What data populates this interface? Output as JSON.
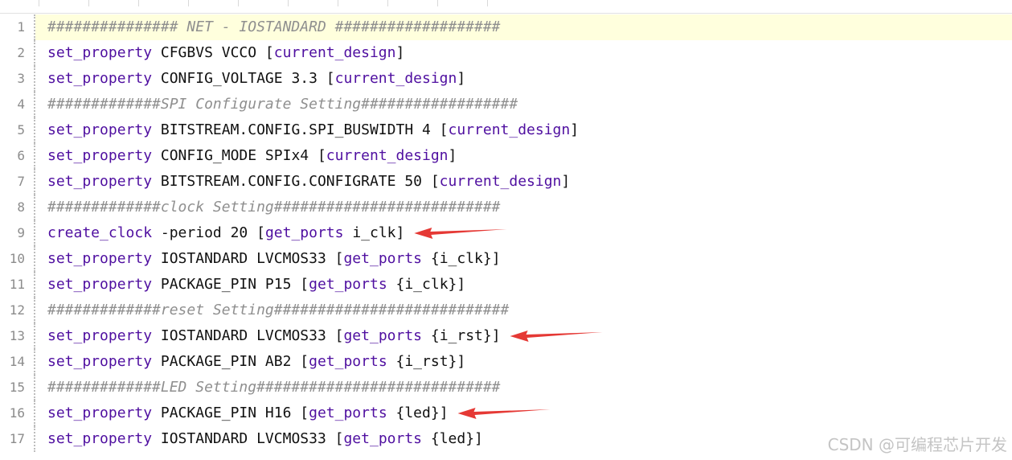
{
  "watermark": "CSDN @可编程芯片开发",
  "lines": [
    {
      "n": "1",
      "current": true,
      "parts": [
        {
          "t": "############### NET - IOSTANDARD ###################",
          "c": "cm"
        }
      ]
    },
    {
      "n": "2",
      "parts": [
        {
          "t": "set_property",
          "c": "kw"
        },
        {
          "t": " CFGBVS VCCO [",
          "c": "pl"
        },
        {
          "t": "current_design",
          "c": "kw"
        },
        {
          "t": "]",
          "c": "pl"
        }
      ]
    },
    {
      "n": "3",
      "parts": [
        {
          "t": "set_property",
          "c": "kw"
        },
        {
          "t": " CONFIG_VOLTAGE 3.3 [",
          "c": "pl"
        },
        {
          "t": "current_design",
          "c": "kw"
        },
        {
          "t": "]",
          "c": "pl"
        }
      ]
    },
    {
      "n": "4",
      "parts": [
        {
          "t": "#############SPI Configurate Setting##################",
          "c": "cm"
        }
      ]
    },
    {
      "n": "5",
      "parts": [
        {
          "t": "set_property",
          "c": "kw"
        },
        {
          "t": " BITSTREAM.CONFIG.SPI_BUSWIDTH 4 [",
          "c": "pl"
        },
        {
          "t": "current_design",
          "c": "kw"
        },
        {
          "t": "]",
          "c": "pl"
        }
      ]
    },
    {
      "n": "6",
      "parts": [
        {
          "t": "set_property",
          "c": "kw"
        },
        {
          "t": " CONFIG_MODE SPIx4 [",
          "c": "pl"
        },
        {
          "t": "current_design",
          "c": "kw"
        },
        {
          "t": "]",
          "c": "pl"
        }
      ]
    },
    {
      "n": "7",
      "parts": [
        {
          "t": "set_property",
          "c": "kw"
        },
        {
          "t": " BITSTREAM.CONFIG.CONFIGRATE 50 [",
          "c": "pl"
        },
        {
          "t": "current_design",
          "c": "kw"
        },
        {
          "t": "]",
          "c": "pl"
        }
      ]
    },
    {
      "n": "8",
      "parts": [
        {
          "t": "#############clock Setting##########################",
          "c": "cm"
        }
      ]
    },
    {
      "n": "9",
      "parts": [
        {
          "t": "create_clock",
          "c": "kw"
        },
        {
          "t": " -period 20 [",
          "c": "pl"
        },
        {
          "t": "get_ports",
          "c": "kw"
        },
        {
          "t": " i_clk]",
          "c": "pl"
        }
      ]
    },
    {
      "n": "10",
      "parts": [
        {
          "t": "set_property",
          "c": "kw"
        },
        {
          "t": " IOSTANDARD LVCMOS33 [",
          "c": "pl"
        },
        {
          "t": "get_ports",
          "c": "kw"
        },
        {
          "t": " {i_clk}]",
          "c": "pl"
        }
      ]
    },
    {
      "n": "11",
      "parts": [
        {
          "t": "set_property",
          "c": "kw"
        },
        {
          "t": " PACKAGE_PIN P15 [",
          "c": "pl"
        },
        {
          "t": "get_ports",
          "c": "kw"
        },
        {
          "t": " {i_clk}]",
          "c": "pl"
        }
      ]
    },
    {
      "n": "12",
      "parts": [
        {
          "t": "#############reset Setting###########################",
          "c": "cm"
        }
      ]
    },
    {
      "n": "13",
      "parts": [
        {
          "t": "set_property",
          "c": "kw"
        },
        {
          "t": " IOSTANDARD LVCMOS33 [",
          "c": "pl"
        },
        {
          "t": "get_ports",
          "c": "kw"
        },
        {
          "t": " {i_rst}]",
          "c": "pl"
        }
      ]
    },
    {
      "n": "14",
      "parts": [
        {
          "t": "set_property",
          "c": "kw"
        },
        {
          "t": " PACKAGE_PIN AB2 [",
          "c": "pl"
        },
        {
          "t": "get_ports",
          "c": "kw"
        },
        {
          "t": " {i_rst}]",
          "c": "pl"
        }
      ]
    },
    {
      "n": "15",
      "parts": [
        {
          "t": "#############LED Setting############################",
          "c": "cm"
        }
      ]
    },
    {
      "n": "16",
      "parts": [
        {
          "t": "set_property",
          "c": "kw"
        },
        {
          "t": " PACKAGE_PIN H16 [",
          "c": "pl"
        },
        {
          "t": "get_ports",
          "c": "kw"
        },
        {
          "t": " {led}]",
          "c": "pl"
        }
      ]
    },
    {
      "n": "17",
      "parts": [
        {
          "t": "set_property",
          "c": "kw"
        },
        {
          "t": " IOSTANDARD LVCMOS33 [",
          "c": "pl"
        },
        {
          "t": "get_ports",
          "c": "kw"
        },
        {
          "t": " {led}]",
          "c": "pl"
        }
      ]
    }
  ],
  "annotations": {
    "arrow_color": "#e53935",
    "arrows": [
      {
        "line": "9"
      },
      {
        "line": "13"
      },
      {
        "line": "16"
      }
    ]
  }
}
